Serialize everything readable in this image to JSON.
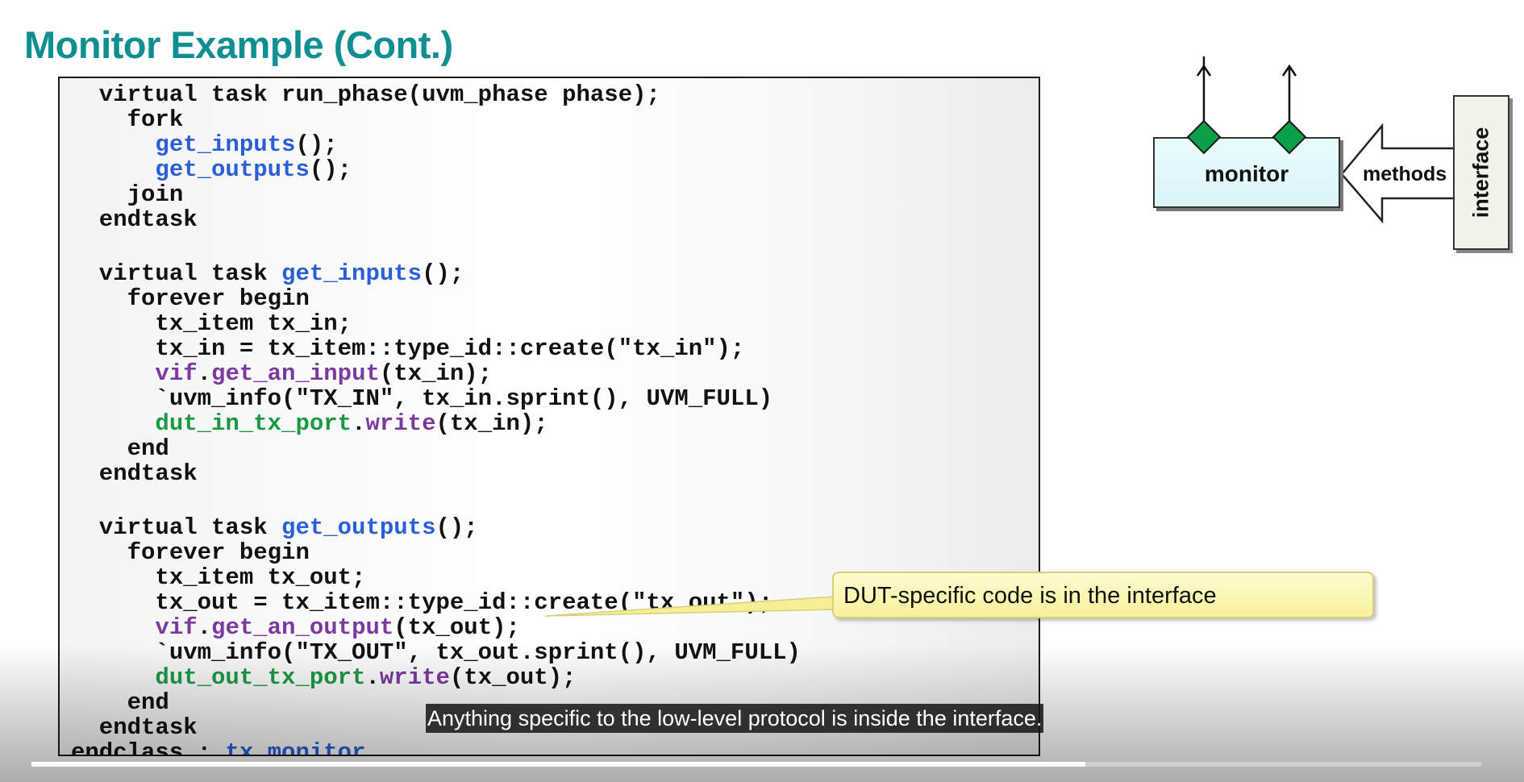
{
  "slide": {
    "title": "Monitor Example (Cont.)"
  },
  "code": {
    "lines": [
      [
        {
          "t": "  virtual task run_phase(uvm_phase phase);"
        }
      ],
      [
        {
          "t": "    fork"
        }
      ],
      [
        {
          "t": "      "
        },
        {
          "t": "get_inputs",
          "c": "blue"
        },
        {
          "t": "();"
        }
      ],
      [
        {
          "t": "      "
        },
        {
          "t": "get_outputs",
          "c": "blue"
        },
        {
          "t": "();"
        }
      ],
      [
        {
          "t": "    join"
        }
      ],
      [
        {
          "t": "  endtask"
        }
      ],
      [],
      [
        {
          "t": "  virtual task "
        },
        {
          "t": "get_inputs",
          "c": "blue"
        },
        {
          "t": "();"
        }
      ],
      [
        {
          "t": "    forever begin"
        }
      ],
      [
        {
          "t": "      tx_item tx_in;"
        }
      ],
      [
        {
          "t": "      tx_in = tx_item::type_id::create(\"tx_in\");"
        }
      ],
      [
        {
          "t": "      "
        },
        {
          "t": "vif",
          "c": "purple"
        },
        {
          "t": "."
        },
        {
          "t": "get_an_input",
          "c": "purple"
        },
        {
          "t": "(tx_in);"
        }
      ],
      [
        {
          "t": "      `uvm_info(\"TX_IN\", tx_in.sprint(), UVM_FULL)"
        }
      ],
      [
        {
          "t": "      "
        },
        {
          "t": "dut_in_tx_port",
          "c": "green"
        },
        {
          "t": "."
        },
        {
          "t": "write",
          "c": "purple"
        },
        {
          "t": "(tx_in);"
        }
      ],
      [
        {
          "t": "    end"
        }
      ],
      [
        {
          "t": "  endtask"
        }
      ],
      [],
      [
        {
          "t": "  virtual task "
        },
        {
          "t": "get_outputs",
          "c": "blue"
        },
        {
          "t": "();"
        }
      ],
      [
        {
          "t": "    forever begin"
        }
      ],
      [
        {
          "t": "      tx_item tx_out;"
        }
      ],
      [
        {
          "t": "      tx_out = tx_item::type_id::create(\"tx_out\");"
        }
      ],
      [
        {
          "t": "      "
        },
        {
          "t": "vif",
          "c": "purple"
        },
        {
          "t": "."
        },
        {
          "t": "get_an_output",
          "c": "purple"
        },
        {
          "t": "(tx_out);"
        }
      ],
      [
        {
          "t": "      `uvm_info(\"TX_OUT\", tx_out.sprint(), UVM_FULL)"
        }
      ],
      [
        {
          "t": "      "
        },
        {
          "t": "dut_out_tx_port",
          "c": "green"
        },
        {
          "t": "."
        },
        {
          "t": "write",
          "c": "purple"
        },
        {
          "t": "(tx_out);"
        }
      ],
      [
        {
          "t": "    end"
        }
      ],
      [
        {
          "t": "  endtask"
        }
      ],
      [
        {
          "t": "endclass : "
        },
        {
          "t": "tx_monitor",
          "c": "blue"
        }
      ]
    ],
    "colors": {
      "blue": "#2a5fd8",
      "purple": "#7b3aa0",
      "green": "#1b9a45"
    }
  },
  "diagram": {
    "monitor_label": "monitor",
    "methods_label": "methods",
    "interface_label": "interface",
    "port_color": "#0aa04a"
  },
  "callout": {
    "text": "DUT-specific code is in the interface"
  },
  "video": {
    "caption": "Anything specific to the low-level protocol is inside the interface.",
    "progress": 0.727
  }
}
